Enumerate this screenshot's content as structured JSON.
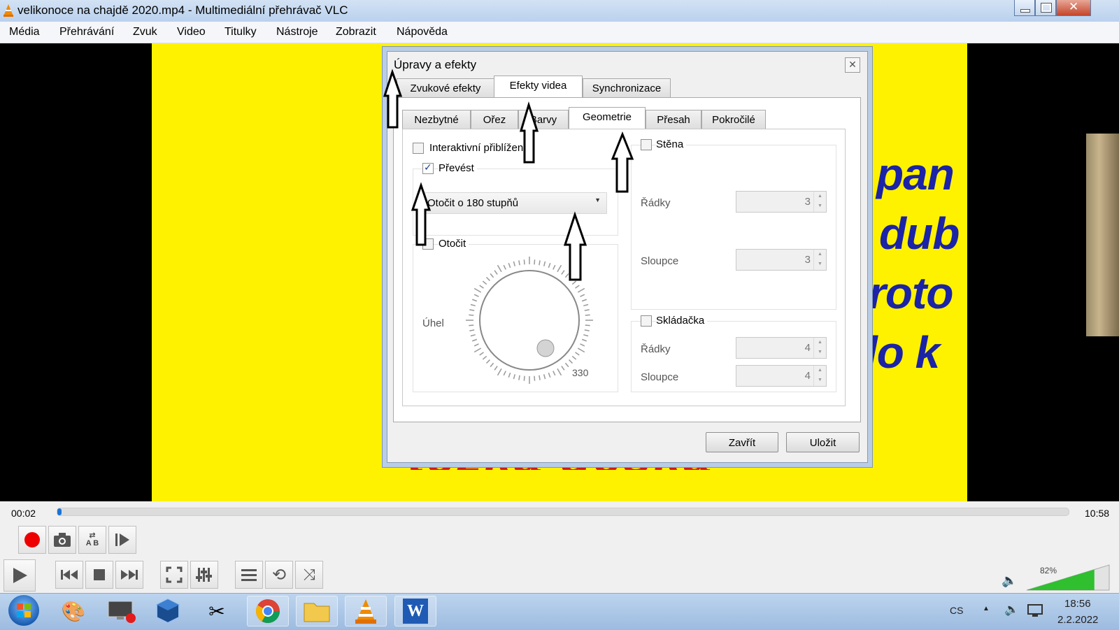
{
  "window": {
    "title": "velikonoce na chajdě 2020.mp4 - Multimediální přehrávač VLC"
  },
  "menu": [
    "Média",
    "Přehrávání",
    "Zvuk",
    "Video",
    "Titulky",
    "Nástroje",
    "Zobrazit",
    "Nápověda"
  ],
  "video_text": {
    "lines": [
      "pan",
      "dub",
      "roto",
      "lo k"
    ],
    "bottom_partial": "tezka deska"
  },
  "dialog": {
    "title": "Úpravy a efekty",
    "tabs": [
      "Zvukové efekty",
      "Efekty videa",
      "Synchronizace"
    ],
    "active_tab": "Efekty videa",
    "subtabs": [
      "Nezbytné",
      "Ořez",
      "Barvy",
      "Geometrie",
      "Přesah",
      "Pokročilé"
    ],
    "active_subtab": "Geometrie",
    "interactive_zoom": {
      "label": "Interaktivní přiblížení",
      "checked": false
    },
    "transform": {
      "label": "Převést",
      "checked": true,
      "selected": "Otočit o 180 stupňů"
    },
    "rotate": {
      "label": "Otočit",
      "checked": false,
      "angle_label": "Úhel",
      "dial_value": "330"
    },
    "wall": {
      "label": "Stěna",
      "checked": false,
      "rows_label": "Řádky",
      "rows": "3",
      "cols_label": "Sloupce",
      "cols": "3"
    },
    "puzzle": {
      "label": "Skládačka",
      "checked": false,
      "rows_label": "Řádky",
      "rows": "4",
      "cols_label": "Sloupce",
      "cols": "4"
    },
    "close_button": "Zavřít",
    "save_button": "Uložit"
  },
  "player": {
    "elapsed": "00:02",
    "total": "10:58",
    "progress": 0.003,
    "volume": "82%"
  },
  "taskbar": {
    "lang": "CS",
    "time": "18:56",
    "date": "2.2.2022"
  },
  "colors": {
    "video_bg": "#fff200",
    "video_text": "#1b23a6",
    "accent": "#1a73d9"
  }
}
